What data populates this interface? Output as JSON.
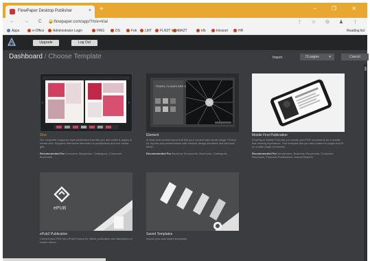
{
  "browser": {
    "tab_title": "FlowPaper Desktop Publisher",
    "tab_close": "×",
    "new_tab": "+",
    "window_controls": "–  ❐  ✕",
    "nav_icons": "←  →  C  ⌂",
    "url": "flowpaper.com/app/?mix=trial",
    "toolbar_icons": "⋮  ☆  ⊙  ♟  ⋮",
    "bookmarks": [
      "Apps",
      "e-Office",
      "Administrator Login",
      "HRG",
      "DS",
      "Fok",
      "LMT",
      "FLN2T login",
      "MAZT",
      "kfb",
      "Intranet",
      "HR"
    ],
    "reading_list": "Reading list"
  },
  "app": {
    "header": {
      "upgrade_label": "Upgrade",
      "logout_label": "Log Out"
    },
    "breadcrumb": {
      "root": "Dashboard",
      "separator": " / ",
      "current": "Choose Template"
    },
    "import": {
      "label": "Import",
      "value": "IS pages",
      "chevron": "▾"
    },
    "cancel_label": "Cancel",
    "cards": [
      {
        "title": "Zine",
        "desc": "Our complete magazine style publication that lets you add content, pages or create new. Supports interactive elements on publications and rich media gifs.",
        "rec_label": "Recommended For",
        "rec": "Consumer Magazines, Catalogues, Consumer Brochures"
      },
      {
        "title": "Element",
        "desc": "A clean and neutral layout that lets your content take center stage. Perfect for reports and presentations with minimal design elements and fast load times.",
        "rec_label": "Recommended For",
        "rec": "Business Documents, Brochures, Catalogues"
      },
      {
        "title": "Mobile First Publication",
        "desc": "FlowPaper Mobile First lets you create your PDF documents for a mobile first viewing experience. This template lets you add content to pages that fit on a wide range of screens.",
        "rec_label": "Recommended For",
        "rec": "Newsletters, Business Documents, Consumer Brochures, Financial Publications, Annual Reports"
      },
      {
        "title": "ePub3 Publication",
        "desc": "Convert your PDF into ePub3 format for offline publication and distribution in reader stores.",
        "rec_label": "",
        "rec": ""
      },
      {
        "title": "Saved Templates",
        "desc": "Import your own saved templates.",
        "rec_label": "",
        "rec": ""
      }
    ],
    "epub_logo_text": "ePUB",
    "element_headline": "TRAVEL PLANES ARE GLOBAL ONES"
  },
  "colors": {
    "accent": "#e89030",
    "app_bg": "#3a3c3f",
    "header_bg": "#232527",
    "tabbar": "#e8a830"
  }
}
